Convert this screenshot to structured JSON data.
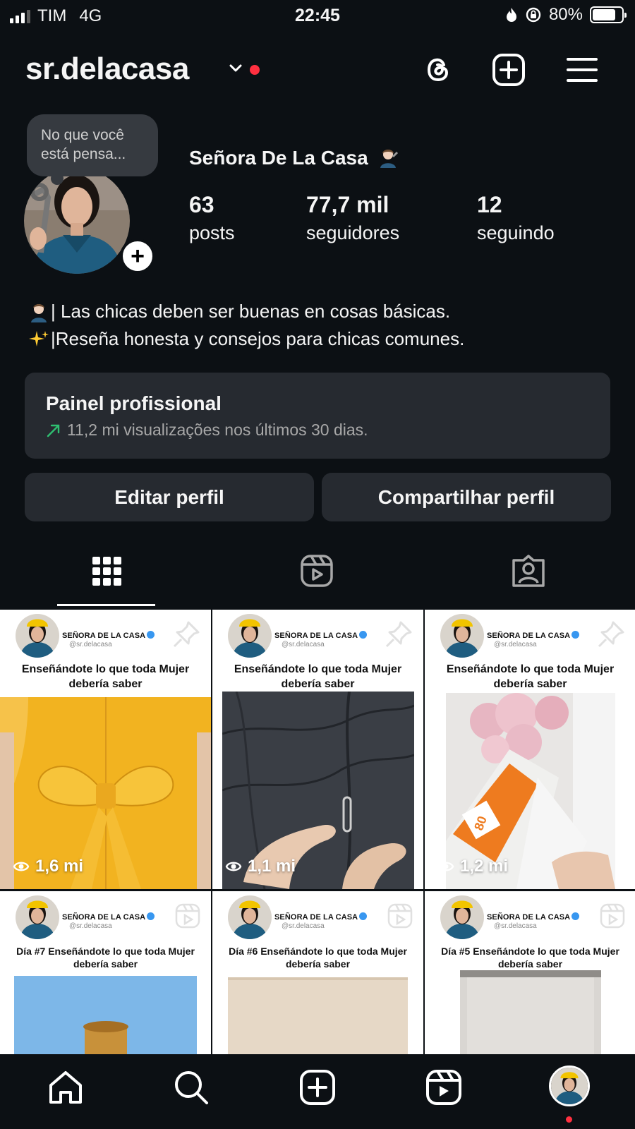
{
  "status": {
    "carrier": "TIM",
    "network": "4G",
    "time": "22:45",
    "battery": "80%",
    "battery_level": 0.8
  },
  "header": {
    "username": "sr.delacasa"
  },
  "profile": {
    "note": "No que você está pensa...",
    "display_name": "Señora De La Casa",
    "stats": [
      {
        "value": "63",
        "label": "posts"
      },
      {
        "value": "77,7 mil",
        "label": "seguidores"
      },
      {
        "value": "12",
        "label": "seguindo"
      }
    ],
    "bio": [
      "| Las chicas deben ser buenas en cosas básicas.",
      "|Reseña honesta y consejos para chicas comunes."
    ]
  },
  "dashboard": {
    "title": "Painel profissional",
    "subtitle": "11,2 mi visualizações nos últimos 30 dias."
  },
  "buttons": {
    "edit": "Editar perfil",
    "share": "Compartilhar perfil"
  },
  "posts": [
    {
      "brand": "SEÑORA DE LA CASA",
      "handle": "@sr.delacasa",
      "caption": "Enseñándote lo que toda Mujer debería saber",
      "views": "1,6 mi"
    },
    {
      "brand": "SEÑORA DE LA CASA",
      "handle": "@sr.delacasa",
      "caption": "Enseñándote lo que toda Mujer debería saber",
      "views": "1,1 mi"
    },
    {
      "brand": "SEÑORA DE LA CASA",
      "handle": "@sr.delacasa",
      "caption": "Enseñándote lo que toda Mujer debería saber",
      "views": "1,2 mi"
    },
    {
      "brand": "SEÑORA DE LA CASA",
      "handle": "@sr.delacasa",
      "caption": "Día #7 Enseñándote lo que toda Mujer debería saber"
    },
    {
      "brand": "SEÑORA DE LA CASA",
      "handle": "@sr.delacasa",
      "caption": "Día #6 Enseñándote lo que toda Mujer debería saber"
    },
    {
      "brand": "SEÑORA DE LA CASA",
      "handle": "@sr.delacasa",
      "caption": "Día #5 Enseñándote lo que toda Mujer debería saber"
    }
  ],
  "icons": {
    "header": [
      "threads-icon",
      "create-icon",
      "menu-icon"
    ],
    "tabs": [
      "grid-icon",
      "reels-icon",
      "tagged-icon"
    ],
    "nav": [
      "home-icon",
      "search-icon",
      "create-icon",
      "reels-icon",
      "profile-avatar"
    ]
  },
  "colors": {
    "background": "#0c1014",
    "card": "#262a30",
    "notification": "#ff3040",
    "trend": "#2fbf71",
    "verified": "#3897f0"
  }
}
